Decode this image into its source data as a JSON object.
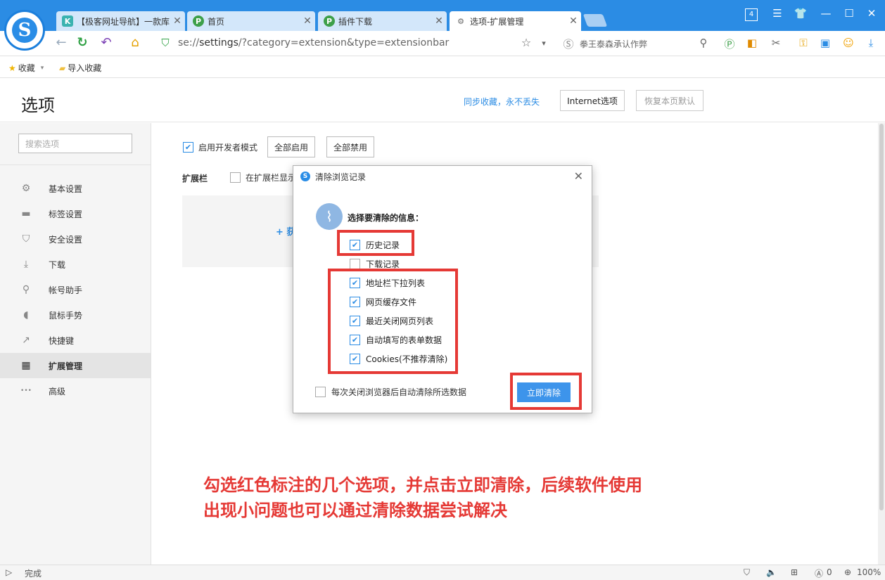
{
  "browser": {
    "tabs": [
      {
        "label": "【极客网址导航】一款库",
        "icon": "K"
      },
      {
        "label": "首页",
        "icon": "P"
      },
      {
        "label": "插件下载",
        "icon": "P"
      },
      {
        "label": "选项-扩展管理",
        "icon": "⚙"
      }
    ],
    "tab_count": "4",
    "address_prefix": "se://",
    "address_bold": "settings",
    "address_rest": "/?category=extension&type=extensionbar",
    "search_text": "拳王泰森承认作弊",
    "bookmarks": [
      "收藏",
      "导入收藏"
    ]
  },
  "page": {
    "title": "选项",
    "sync_link": "同步收藏，永不丢失",
    "internet_options": "Internet选项",
    "restore_default": "恢复本页默认"
  },
  "sidebar": {
    "search_placeholder": "搜索选项",
    "items": [
      {
        "label": "基本设置",
        "icon": "⚙"
      },
      {
        "label": "标签设置",
        "icon": "▬"
      },
      {
        "label": "安全设置",
        "icon": "⛉"
      },
      {
        "label": "下载",
        "icon": "⤓"
      },
      {
        "label": "帐号助手",
        "icon": "⚲"
      },
      {
        "label": "鼠标手势",
        "icon": "◖"
      },
      {
        "label": "快捷键",
        "icon": "↗"
      },
      {
        "label": "扩展管理",
        "icon": "▦"
      },
      {
        "label": "高级",
        "icon": "•••"
      }
    ]
  },
  "main": {
    "dev_mode": "启用开发者模式",
    "enable_all": "全部启用",
    "disable_all": "全部禁用",
    "ext_bar_label": "扩展栏",
    "show_in_bar": "在扩展栏显示",
    "add_ext": "+ 获"
  },
  "dialog": {
    "title": "清除浏览记录",
    "prompt": "选择要清除的信息：",
    "options": [
      {
        "label": "历史记录",
        "checked": true
      },
      {
        "label": "下载记录",
        "checked": false
      },
      {
        "label": "地址栏下拉列表",
        "checked": true
      },
      {
        "label": "网页缓存文件",
        "checked": true
      },
      {
        "label": "最近关闭网页列表",
        "checked": true
      },
      {
        "label": "自动填写的表单数据",
        "checked": true
      },
      {
        "label": "Cookies(不推荐清除)",
        "checked": true
      }
    ],
    "auto_clear": "每次关闭浏览器后自动清除所选数据",
    "clear_button": "立即清除"
  },
  "annotation": {
    "line1": "勾选红色标注的几个选项，并点击立即清除，后续软件使用",
    "line2": "出现小问题也可以通过清除数据尝试解决"
  },
  "statusbar": {
    "status": "完成",
    "count": "0",
    "zoom": "100%"
  },
  "colors": {
    "accent": "#2b8ce4",
    "annotation_red": "#e53935"
  }
}
